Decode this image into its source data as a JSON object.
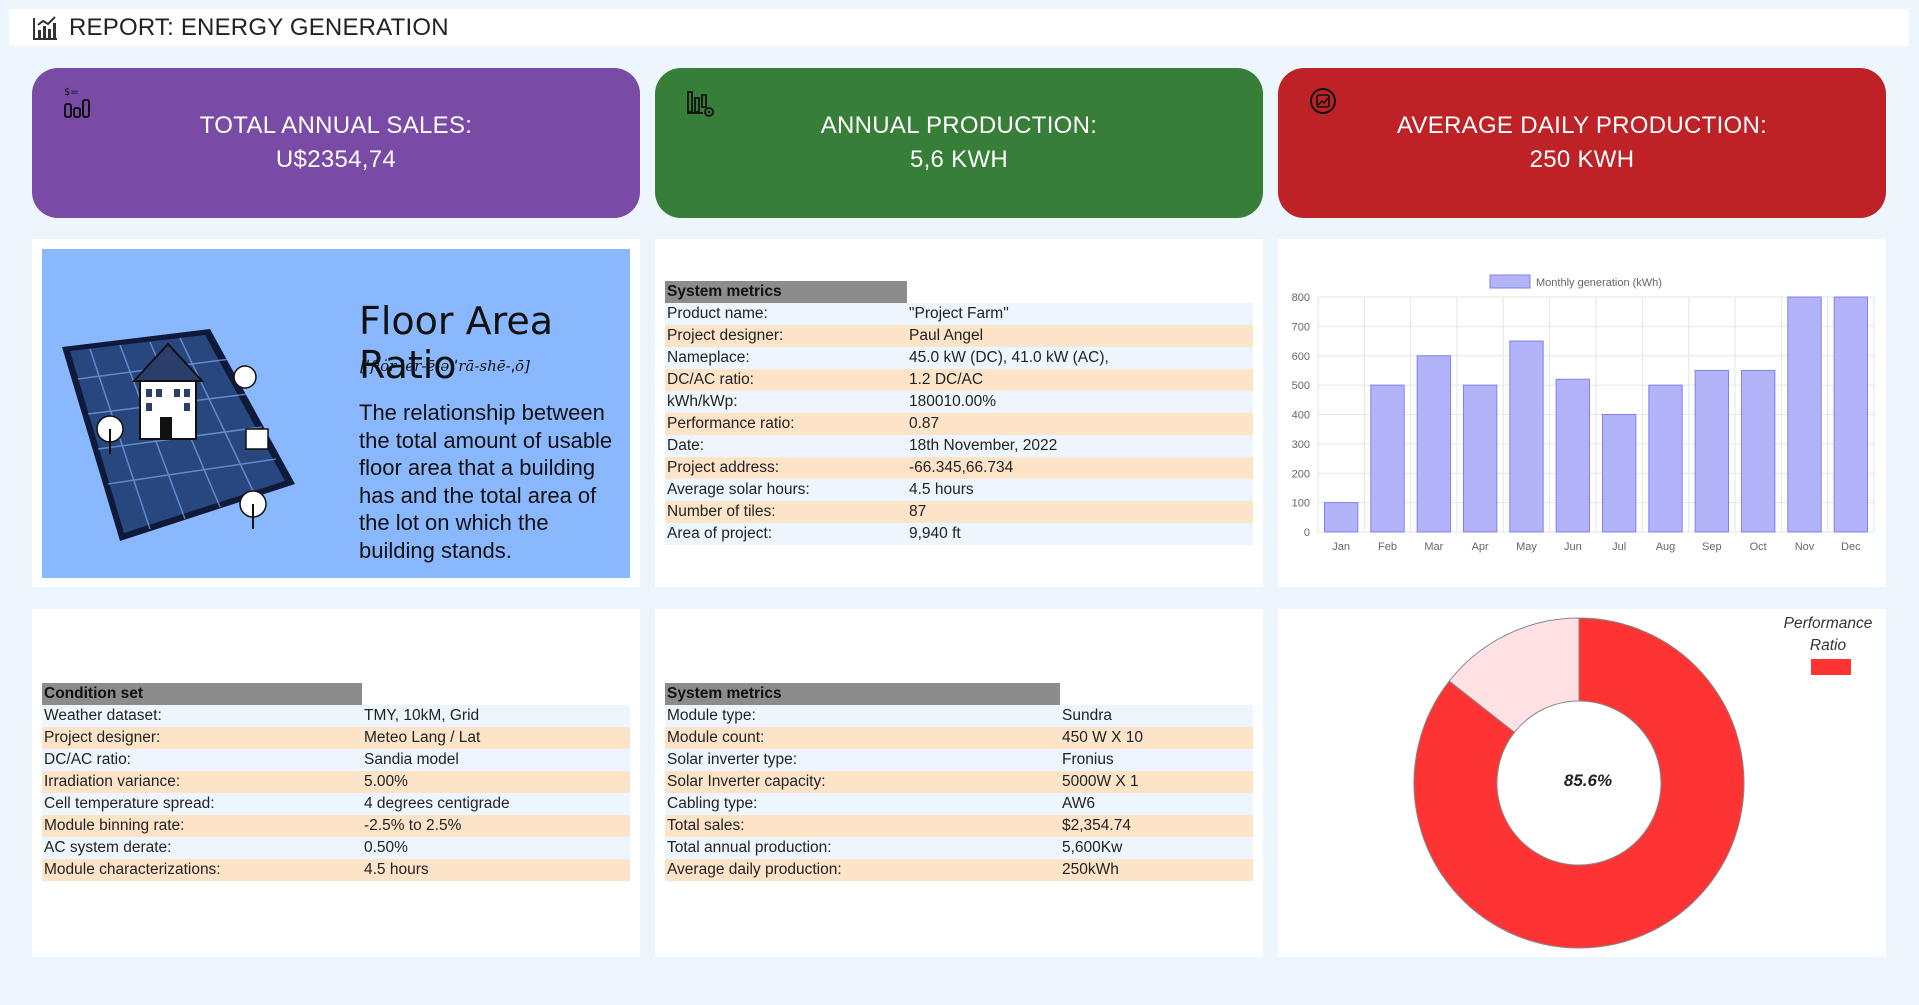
{
  "header": {
    "title": "REPORT: ENERGY GENERATION",
    "icon": "chart-icon"
  },
  "kpis": [
    {
      "label": "TOTAL ANNUAL SALES:",
      "value": "U$2354,74",
      "color": "#7a4aa7",
      "icon": "sales-icon"
    },
    {
      "label": "ANNUAL PRODUCTION:",
      "value": "5,6 KWH",
      "color": "#377e38",
      "icon": "production-icon"
    },
    {
      "label": "AVERAGE DAILY PRODUCTION:",
      "value": "250 KWH",
      "color": "#be2226",
      "icon": "daily-icon"
    }
  ],
  "far": {
    "title": "Floor Area Ratio",
    "pronunciation": "[ˈflȯr ˈer-ē-ə ˈrā-shē-ˌō]",
    "description": "The relationship between the total amount of usable floor area that a building has and the total area of the lot on which the building stands.",
    "background": "#8ab8fe"
  },
  "system_metrics_1": {
    "header": "System metrics",
    "rows": [
      [
        "Product name:",
        "\"Project Farm\""
      ],
      [
        "Project designer:",
        "Paul Angel"
      ],
      [
        "Nameplace:",
        "45.0 kW (DC), 41.0 kW (AC),"
      ],
      [
        "DC/AC ratio:",
        "1.2 DC/AC"
      ],
      [
        "kWh/kWp:",
        "180010.00%"
      ],
      [
        "Performance ratio:",
        "0.87"
      ],
      [
        "Date:",
        "18th November, 2022"
      ],
      [
        "Project address:",
        "-66.345,66.734"
      ],
      [
        "Average solar hours:",
        "4.5 hours"
      ],
      [
        "Number of tiles:",
        "87"
      ],
      [
        "Area of project:",
        "9,940 ft"
      ]
    ]
  },
  "condition_set": {
    "header": "Condition set",
    "rows": [
      [
        "Weather dataset:",
        "TMY, 10kM, Grid"
      ],
      [
        "Project designer:",
        "Meteo Lang / Lat"
      ],
      [
        "DC/AC ratio:",
        "Sandia model"
      ],
      [
        "Irradiation variance:",
        "5.00%"
      ],
      [
        "Cell temperature spread:",
        "4 degrees centigrade"
      ],
      [
        "Module binning rate:",
        "-2.5% to 2.5%"
      ],
      [
        "AC system derate:",
        "0.50%"
      ],
      [
        "Module characterizations:",
        "4.5 hours"
      ]
    ]
  },
  "system_metrics_2": {
    "header": "System metrics",
    "rows": [
      [
        "Module type:",
        "Sundra"
      ],
      [
        "Module count:",
        "450 W X 10"
      ],
      [
        "Solar inverter type:",
        "Fronius"
      ],
      [
        "Solar Inverter capacity:",
        "5000W X 1"
      ],
      [
        "Cabling type:",
        "AW6"
      ],
      [
        "Total sales:",
        "$2,354.74"
      ],
      [
        "Total annual production:",
        "5,600Kw"
      ],
      [
        "Average daily production:",
        "250kWh"
      ]
    ]
  },
  "colors": {
    "row_even": "#eef6fd",
    "row_odd": "#fde4c9",
    "header_gray": "#8c8c8c",
    "bar_fill": "#b3b3fa",
    "bar_stroke": "#8080f0",
    "pie_red": "#fe3333",
    "pie_light": "#ffe0e3"
  },
  "chart_data": [
    {
      "type": "bar",
      "categories": [
        "Jan",
        "Feb",
        "Mar",
        "Apr",
        "May",
        "Jun",
        "Jul",
        "Aug",
        "Sep",
        "Oct",
        "Nov",
        "Dec"
      ],
      "series": [
        {
          "name": "Monthly generation (kWh)",
          "values": [
            100,
            500,
            600,
            500,
            650,
            520,
            400,
            500,
            550,
            550,
            800,
            800
          ]
        }
      ],
      "ylim": [
        0,
        800
      ],
      "yticks": [
        0,
        100,
        200,
        300,
        400,
        500,
        600,
        700,
        800
      ],
      "grid": true,
      "legend": "top"
    },
    {
      "type": "pie",
      "legend_title": "Performance Ratio",
      "center_label": "85.6%",
      "values": [
        85.6,
        14.4
      ],
      "legend": "top-right"
    }
  ]
}
